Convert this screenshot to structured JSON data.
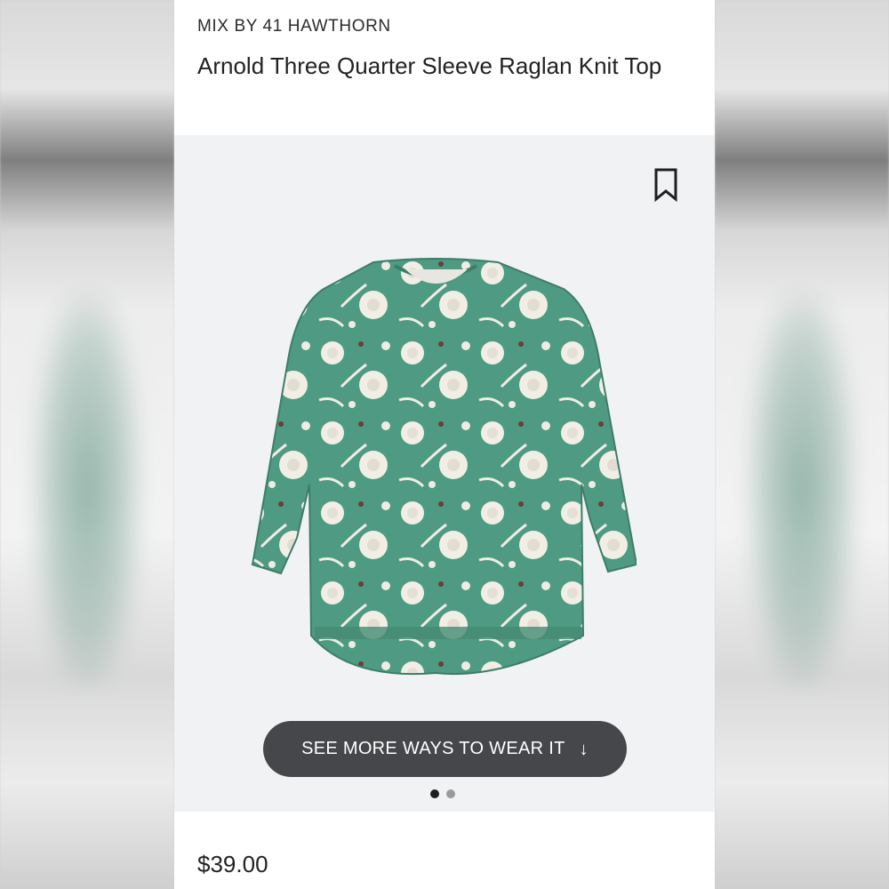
{
  "brand": "MIX BY 41 HAWTHORN",
  "product": {
    "title": "Arnold Three Quarter Sleeve Raglan Knit Top",
    "price": "$39.00"
  },
  "cta": {
    "label": "SEE MORE WAYS TO WEAR IT",
    "arrow": "↓"
  },
  "carousel": {
    "total": 2,
    "active": 1
  },
  "icons": {
    "bookmark": "bookmark-icon",
    "arrow": "arrow-down-icon"
  },
  "colors": {
    "shirt_green": "#4f9a82",
    "floral_cream": "#f3f0e8",
    "button_bg": "#45474b",
    "panel_bg": "#f1f2f4"
  }
}
